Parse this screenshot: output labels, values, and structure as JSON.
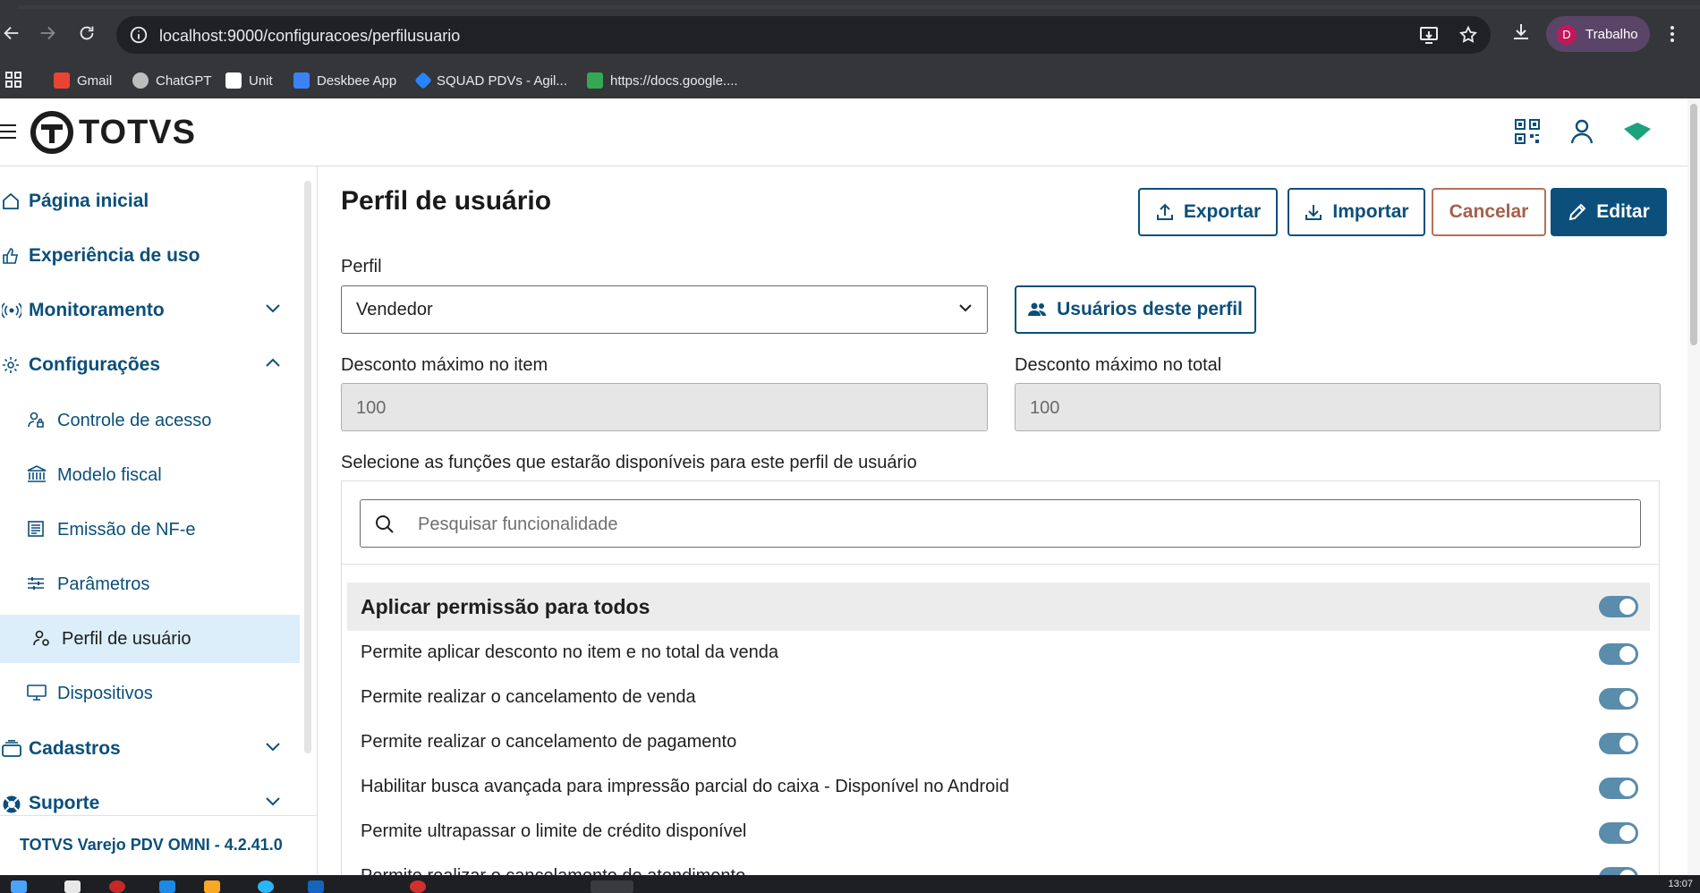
{
  "browser": {
    "url": "localhost:9000/configuracoes/perfilusuario",
    "profile_label": "Trabalho",
    "profile_initial": "D",
    "bookmarks": [
      {
        "label": "Gmail",
        "color": "#ea4335"
      },
      {
        "label": "ChatGPT",
        "color": "#bdbdbd"
      },
      {
        "label": "Unit",
        "color": "#ffffff"
      },
      {
        "label": "Deskbee App",
        "color": "#3b82f6"
      },
      {
        "label": "SQUAD PDVs - Agil...",
        "color": "#2684ff"
      },
      {
        "label": "https://docs.google....",
        "color": "#34a853"
      }
    ]
  },
  "app": {
    "logo_text": "TOTVS",
    "header_icons": [
      "qrcode-icon",
      "user-icon",
      "status-icon"
    ],
    "brand_color": "#0b4f7a",
    "status_color": "#1ba27e"
  },
  "sidebar": {
    "items": [
      {
        "label": "Página inicial",
        "icon": "home-icon"
      },
      {
        "label": "Experiência de uso",
        "icon": "thumbs-up-icon"
      },
      {
        "label": "Monitoramento",
        "icon": "broadcast-icon",
        "expandable": true
      },
      {
        "label": "Configurações",
        "icon": "gear-icon",
        "expanded": true
      }
    ],
    "sub_items": [
      {
        "label": "Controle de acesso",
        "icon": "user-lock-icon"
      },
      {
        "label": "Modelo fiscal",
        "icon": "bank-icon"
      },
      {
        "label": "Emissão de NF-e",
        "icon": "document-icon"
      },
      {
        "label": "Parâmetros",
        "icon": "sliders-icon"
      },
      {
        "label": "Perfil de usuário",
        "icon": "user-gear-icon",
        "active": true
      },
      {
        "label": "Dispositivos",
        "icon": "monitor-icon"
      }
    ],
    "bottom_items": [
      {
        "label": "Cadastros",
        "icon": "layers-icon"
      },
      {
        "label": "Suporte",
        "icon": "lifebuoy-icon"
      }
    ],
    "version": "TOTVS Varejo PDV OMNI - 4.2.41.0"
  },
  "main": {
    "title": "Perfil de usuário",
    "buttons": {
      "export": "Exportar",
      "import": "Importar",
      "cancel": "Cancelar",
      "edit": "Editar"
    },
    "profile_label": "Perfil",
    "profile_value": "Vendedor",
    "users_button": "Usuários deste perfil",
    "max_item_discount_label": "Desconto máximo no item",
    "max_item_discount_value": "100",
    "max_total_discount_label": "Desconto máximo no total",
    "max_total_discount_value": "100",
    "functions_label": "Selecione as funções que estarão disponíveis para este perfil de usuário",
    "search_placeholder": "Pesquisar funcionalidade",
    "apply_all_label": "Aplicar permissão para todos",
    "apply_all_on": true,
    "permissions": [
      {
        "label": "Permite aplicar desconto no item e no total da venda",
        "on": true
      },
      {
        "label": "Permite realizar o cancelamento de venda",
        "on": true
      },
      {
        "label": "Permite realizar o cancelamento de pagamento",
        "on": true
      },
      {
        "label": "Habilitar busca avançada para impressão parcial do caixa - Disponível no Android",
        "on": true
      },
      {
        "label": "Permite ultrapassar o limite de crédito disponível",
        "on": true
      },
      {
        "label": "Permite realizar o cancelamento de atendimento",
        "on": true
      }
    ]
  },
  "taskbar": {
    "clock": "13:07"
  }
}
